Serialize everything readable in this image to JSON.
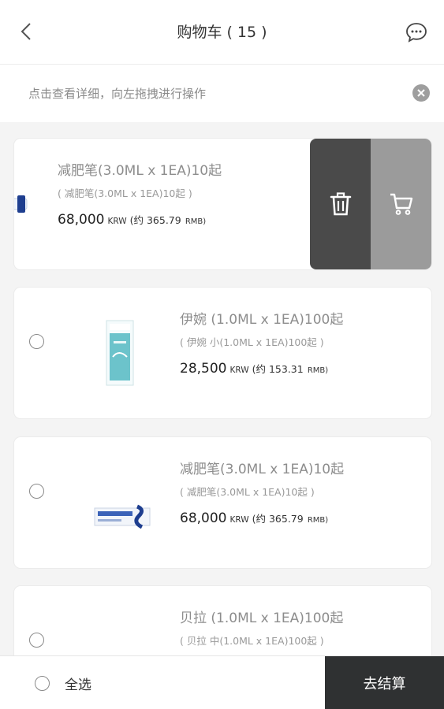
{
  "header": {
    "title": "购物车 ( 15 )",
    "back_icon": "chevron-left-icon",
    "message_icon": "chat-bubble-icon"
  },
  "hint": {
    "text": "点击查看详细，向左拖拽进行操作",
    "close_icon": "close-circle-icon"
  },
  "items": [
    {
      "name": "减肥笔(3.0ML x 1EA)10起",
      "subtitle": "( 减肥笔(3.0ML x 1EA)10起 )",
      "price": "68,000",
      "currency": "KRW",
      "approx": "(约 365.79",
      "rmb": "RMB)",
      "swiped": true,
      "actions": {
        "delete_icon": "trash-icon",
        "cart_icon": "cart-icon"
      }
    },
    {
      "name": "伊婉 (1.0ML x 1EA)100起",
      "subtitle": "( 伊婉 小(1.0ML x 1EA)100起 )",
      "price": "28,500",
      "currency": "KRW",
      "approx": "(约 153.31",
      "rmb": "RMB)"
    },
    {
      "name": "减肥笔(3.0ML x 1EA)10起",
      "subtitle": "( 减肥笔(3.0ML x 1EA)10起 )",
      "price": "68,000",
      "currency": "KRW",
      "approx": "(约 365.79",
      "rmb": "RMB)"
    },
    {
      "name": "贝拉 (1.0ML x 1EA)100起",
      "subtitle": "( 贝拉 中(1.0ML x 1EA)100起 )"
    }
  ],
  "footer": {
    "select_all_label": "全选",
    "checkout_label": "去结算"
  },
  "colors": {
    "checkout_bg": "#2f3132",
    "delete_action": "#4a4a4a",
    "cart_action": "#9b9b9b",
    "list_bg": "#f4f4f4"
  }
}
